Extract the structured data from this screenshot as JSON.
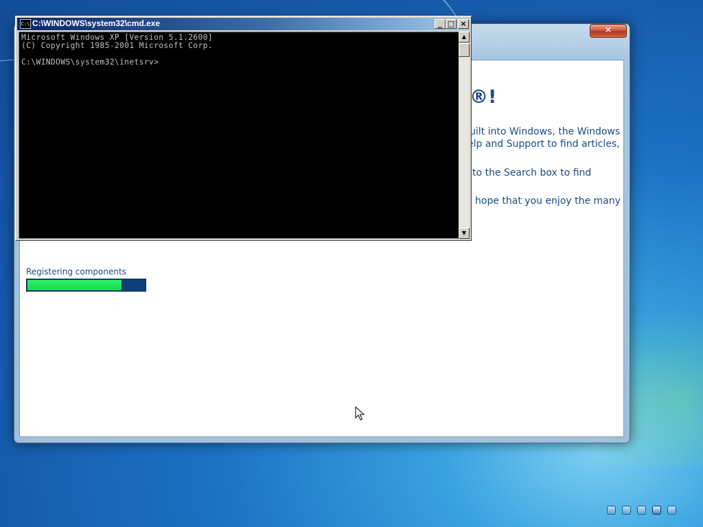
{
  "cmd_window": {
    "title": "C:\\WINDOWS\\system32\\cmd.exe",
    "icon_label": "C:\\",
    "buttons": {
      "minimize": "_",
      "maximize": "□",
      "close": "×"
    },
    "console_lines": [
      "Microsoft Windows XP [Version 5.1.2600]",
      "(C) Copyright 1985-2001 Microsoft Corp.",
      "",
      "C:\\WINDOWS\\system32\\inetsrv>"
    ]
  },
  "setup_window": {
    "close_label": "✕",
    "heading_fragment": "®!",
    "text_fragments": [
      "uilt into Windows, the Windows",
      "elp and Support to find articles,",
      "to the Search box to find",
      "hope that you enjoy the many"
    ],
    "progress": {
      "label": "Registering components",
      "fraction": 0.8
    }
  },
  "step_indicator": {
    "count": 5,
    "active_index": 3
  },
  "colors": {
    "setup_text": "#1b4b82",
    "progress_fill": "#19d84c",
    "progress_track": "#0d3f78",
    "console_bg": "#000000",
    "console_text": "#c0c0c0"
  }
}
